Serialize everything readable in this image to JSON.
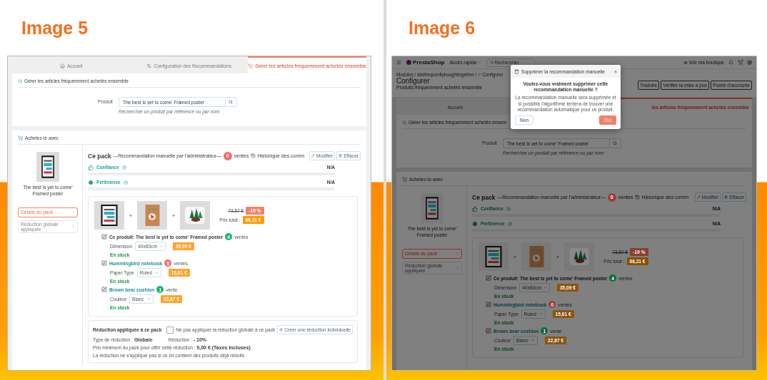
{
  "screens": [
    {
      "caption": "Image 5",
      "tabs": [
        {
          "label": "Accueil",
          "selected": false
        },
        {
          "label": "Configuration des Recommandations",
          "selected": false
        },
        {
          "label": "Gérer les articles fréquemment achetés ensemble",
          "selected": true
        }
      ],
      "search_panel": {
        "title": "Gérer les articles fréquemment achetés ensemble",
        "field_label": "Produit",
        "value": "The best is yet to come' Framed poster",
        "hint": "Rechercher un produit par référence ou par nom"
      },
      "section": {
        "title": "Achetez-le avec",
        "product_name": "The best is yet to come' Framed poster",
        "side_tabs": [
          {
            "label": "Détails du pack",
            "selected": true
          },
          {
            "label": "Réduction globale appliquée",
            "selected": false
          }
        ],
        "pack": {
          "title": "Ce pack",
          "subtitle": "—Recommandation manuelle par l'administrateur—",
          "sales": {
            "count": "0",
            "color": "#f26d6d",
            "label": "ventes"
          },
          "history": "Historique des comm",
          "buttons": [
            {
              "kind": "edit",
              "label": "Modifier"
            },
            {
              "kind": "delete",
              "label": "Effacer"
            }
          ],
          "metrics": [
            {
              "kind": "confidence",
              "label": "Confiance",
              "value": "N/A",
              "level": 0
            },
            {
              "kind": "relevance",
              "label": "Pertinence",
              "value": "N/A",
              "level": 0
            }
          ],
          "separators": [
            "+",
            "+"
          ],
          "old_price": "73,57 €",
          "discount": "-10 %",
          "total_label": "Prix total :",
          "total": "66,21 €",
          "items": [
            {
              "kind": "current",
              "name": "Ce produit: The best is yet to come' Framed poster",
              "sales": "4",
              "color": "#1db56a",
              "sales_label": "ventes",
              "option_label": "Dimension",
              "option_value": "40x60cm",
              "price": "35,09 €",
              "stock": "En stock"
            },
            {
              "kind": "link",
              "name": "Hummingbird notebook",
              "sales": "0",
              "color": "#f26d6d",
              "sales_label": "ventes",
              "option_label": "Paper Type",
              "option_value": "Ruled",
              "price": "15,61 €",
              "stock": "En stock"
            },
            {
              "kind": "link",
              "name": "Brown bear cushion",
              "sales": "1",
              "color": "#1db56a",
              "sales_label": "vente",
              "option_label": "Couleur",
              "option_value": "Blanc",
              "price": "22,87 €",
              "stock": "En stock"
            }
          ]
        },
        "reduction": {
          "title": "Réduction appliquée à ce pack",
          "checkbox": {
            "label": "Ne pas appliquer la réduction globale à ce pack",
            "checked": false
          },
          "button": "Créer une réduction individuelle",
          "type": "Type de réduction : **Globale**",
          "amount": "Réduction : **- 10%**",
          "minimum": "Prix minimum du pack pour offrir cette réduction : **0,00 € (Taxes incluses)**",
          "note": "La réduction ne s'applique pas si ce lot contient des produits déjà réduits"
        }
      }
    },
    {
      "caption": "Image 6",
      "app_header": {
        "logo": "PrestaShop",
        "quick_access": "Accès rapide",
        "search_placeholder": "Rechercher",
        "shop_link": "Voir ma boutique",
        "breadcrumb": "Modules / absfrequentlyboughttogether /",
        "breadcrumb_current": "Configurer",
        "title": "Configurer",
        "subtitle": "Produits fréquemment achetés ensemble",
        "buttons": [
          "Traduire",
          "Vérifier la mise à jour",
          "Points d'accroche"
        ]
      },
      "tabs": [
        {
          "label": "Accueil",
          "selected": false
        },
        {
          "label": "les articles fréquemment achetés ensemble",
          "selected": true
        }
      ],
      "search_panel": {
        "title": "Gérer les articles fréquemment achetés ensem",
        "field_label": "Produit",
        "value": "The best is yet to come' Framed poster",
        "hint": "Rechercher un produit par référence ou par nom"
      },
      "section": {
        "title": "Achetez-le avec",
        "product_name": "The best is yet to come' Framed poster",
        "side_tabs": [
          {
            "label": "Détails du pack",
            "selected": true
          },
          {
            "label": "Réduction globale appliquée",
            "selected": false
          }
        ],
        "pack": {
          "title": "Ce pack",
          "subtitle": "—Recommandation manuelle par l'administrateur—",
          "sales": {
            "count": "0",
            "color": "#9a3f3f",
            "label": "ventes"
          },
          "history": "Historique des comm",
          "buttons": [
            {
              "kind": "edit",
              "label": "Modifier"
            },
            {
              "kind": "delete",
              "label": "Effacer"
            }
          ],
          "metrics": [
            {
              "kind": "confidence",
              "label": "Confiance",
              "value": "N/A",
              "level": 0
            },
            {
              "kind": "relevance",
              "label": "Pertinence",
              "value": "N/A",
              "level": 0
            }
          ],
          "separators": [
            "+",
            "+"
          ],
          "old_price": "73,57 €",
          "discount": "-10 %",
          "total_label": "Prix total :",
          "total": "66,21 €",
          "items": [
            {
              "kind": "current",
              "name": "Ce produit: The best is yet to come' Framed poster",
              "sales": "4",
              "color": "#0e6b3c",
              "sales_label": "ventes",
              "option_label": "Dimension",
              "option_value": "40x60cm",
              "price": "35,09 €",
              "stock": "En stock"
            },
            {
              "kind": "link",
              "name": "Hummingbird notebook",
              "sales": "0",
              "color": "#9a3f3f",
              "sales_label": "ventes",
              "option_label": "Paper Type",
              "option_value": "Ruled",
              "price": "15,61 €",
              "stock": "En stock"
            },
            {
              "kind": "link",
              "name": "Brown bear cushion",
              "sales": "1",
              "color": "#0e6b3c",
              "sales_label": "vente",
              "option_label": "Couleur",
              "option_value": "Blanc",
              "price": "22,87 €",
              "stock": "En stock"
            }
          ]
        }
      },
      "dialog": {
        "title": "Supprimer la recommandation manuelle",
        "close": "×",
        "question": "Voulez-vous vraiment supprimer cette recommandation manuelle ?",
        "body": "La recommandation manuelle sera supprimée et si possible l'algorithme tentera de trouver une recommandation automatique pour ce produit.",
        "cancel": "Non",
        "confirm": "Oui"
      }
    }
  ]
}
